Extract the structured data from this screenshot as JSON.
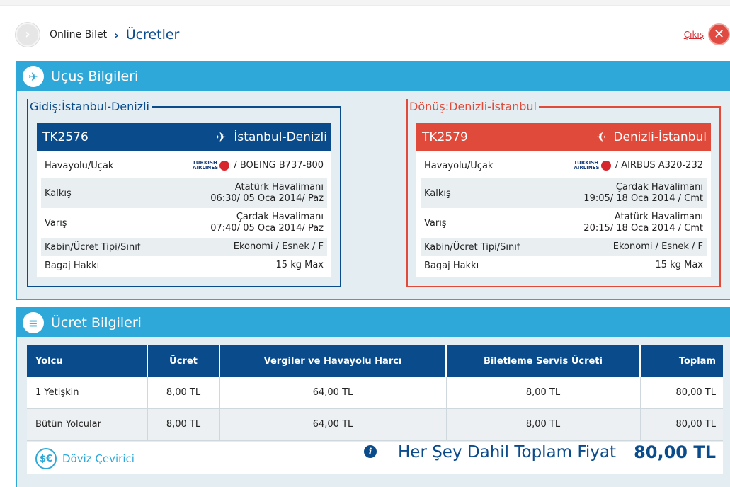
{
  "breadcrumb": {
    "home": "Online Bilet",
    "separator": "›",
    "current": "Ücretler"
  },
  "exit": {
    "label": "Çıkış"
  },
  "flight_section": {
    "title": "Uçuş Bilgileri"
  },
  "outbound": {
    "legend": "Gidiş:İstanbul-Denizli",
    "flight_no": "TK2576",
    "route": "İstanbul-Denizli",
    "airline_logo_text": "TURKISH AIRLINES",
    "labels": {
      "airline": "Havayolu/Uçak",
      "departure": "Kalkış",
      "arrival": "Varış",
      "cabin": "Kabin/Ücret Tipi/Sınıf",
      "baggage": "Bagaj Hakkı"
    },
    "aircraft": "/ BOEING B737-800",
    "departure_airport": "Atatürk Havalimanı",
    "departure_time": "06:30/ 05 Oca 2014/ Paz",
    "arrival_airport": "Çardak Havalimanı",
    "arrival_time": "07:40/ 05 Oca 2014/ Paz",
    "cabin": "Ekonomi / Esnek / F",
    "baggage": "15 kg Max"
  },
  "return": {
    "legend": "Dönüş:Denizli-İstanbul",
    "flight_no": "TK2579",
    "route": "Denizli-İstanbul",
    "airline_logo_text": "TURKISH AIRLINES",
    "labels": {
      "airline": "Havayolu/Uçak",
      "departure": "Kalkış",
      "arrival": "Varış",
      "cabin": "Kabin/Ücret Tipi/Sınıf",
      "baggage": "Bagaj Hakkı"
    },
    "aircraft": "/ AIRBUS A320-232",
    "departure_airport": "Çardak Havalimanı",
    "departure_time": "19:05/ 18 Oca 2014 / Cmt",
    "arrival_airport": "Atatürk Havalimanı",
    "arrival_time": "20:15/ 18 Oca 2014 / Cmt",
    "cabin": "Ekonomi / Esnek / F",
    "baggage": "15 kg Max"
  },
  "price_section": {
    "title": "Ücret Bilgileri",
    "headers": [
      "Yolcu",
      "Ücret",
      "Vergiler ve Havayolu Harcı",
      "Biletleme Servis Ücreti",
      "Toplam"
    ],
    "rows": [
      [
        "1 Yetişkin",
        "8,00 TL",
        "64,00 TL",
        "8,00 TL",
        "80,00 TL"
      ],
      [
        "Bütün Yolcular",
        "8,00 TL",
        "64,00 TL",
        "8,00 TL",
        "80,00 TL"
      ]
    ],
    "currency_converter": "Döviz Çevirici",
    "total_label": "Her Şey Dahil Toplam Fiyat",
    "total_value": "80,00 TL"
  },
  "icons": {
    "crumb": "chevron-right-icon",
    "exit": "close-icon",
    "plane": "airplane-icon",
    "info": "info-icon",
    "currency": "currency-exchange-icon"
  },
  "colors": {
    "accent": "#2ea8d8",
    "outbound": "#0a4b8c",
    "return": "#e04a3a",
    "exit": "#d8262d"
  }
}
